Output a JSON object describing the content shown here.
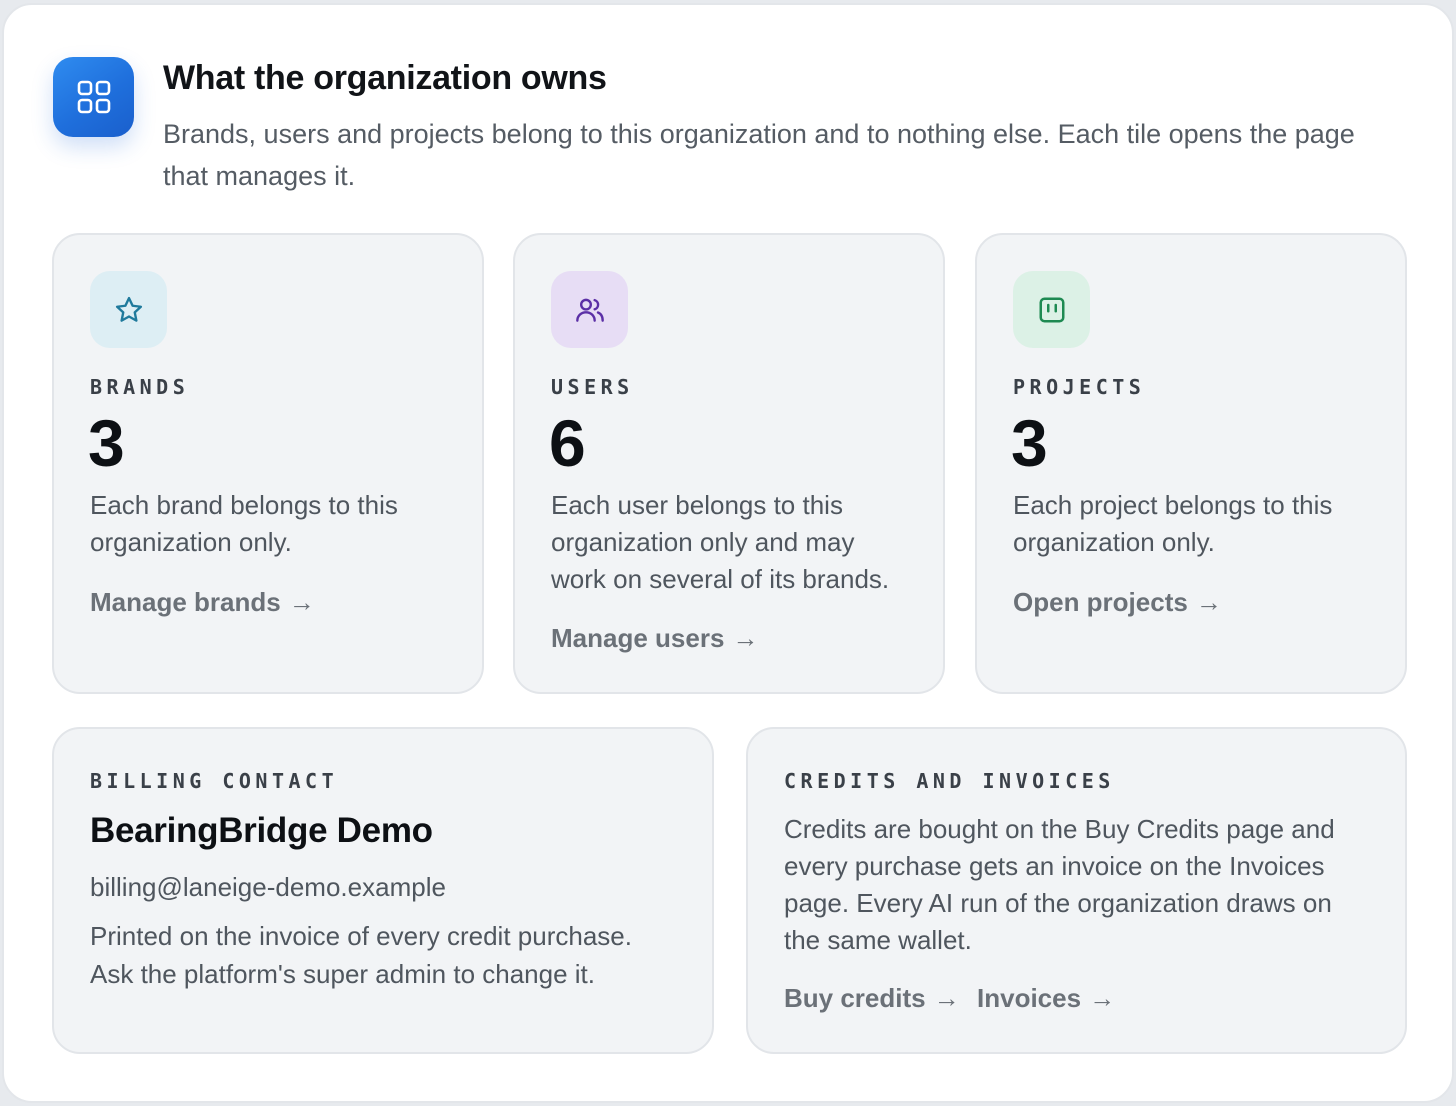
{
  "header": {
    "icon": "grid-icon",
    "title": "What the organization owns",
    "subtitle": "Brands, users and projects belong to this organization and to nothing else. Each tile opens the page that manages it."
  },
  "tiles": [
    {
      "icon": "star-icon",
      "icon_bg": "#ddeef4",
      "icon_color": "#1f7a9c",
      "kicker": "BRANDS",
      "count": "3",
      "description": "Each brand belongs to this organization only.",
      "link": "Manage brands",
      "arrow": "→"
    },
    {
      "icon": "users-icon",
      "icon_bg": "#e7ddf5",
      "icon_color": "#5b2fa6",
      "kicker": "USERS",
      "count": "6",
      "description": "Each user belongs to this organization only and may work on several of its brands.",
      "link": "Manage users",
      "arrow": "→"
    },
    {
      "icon": "project-board-icon",
      "icon_bg": "#dcf1e6",
      "icon_color": "#1e8a52",
      "kicker": "PROJECTS",
      "count": "3",
      "description": "Each project belongs to this organization only.",
      "link": "Open projects",
      "arrow": "→"
    }
  ],
  "billing": {
    "kicker": "BILLING CONTACT",
    "name": "BearingBridge Demo",
    "email": "billing@laneige-demo.example",
    "note": "Printed on the invoice of every credit purchase. Ask the platform's super admin to change it."
  },
  "credits": {
    "kicker": "CREDITS AND INVOICES",
    "description": "Credits are bought on the Buy Credits page and every purchase gets an invoice on the Invoices page. Every AI run of the organization draws on the same wallet.",
    "buy_link": "Buy credits",
    "invoices_link": "Invoices",
    "arrow": "→"
  }
}
